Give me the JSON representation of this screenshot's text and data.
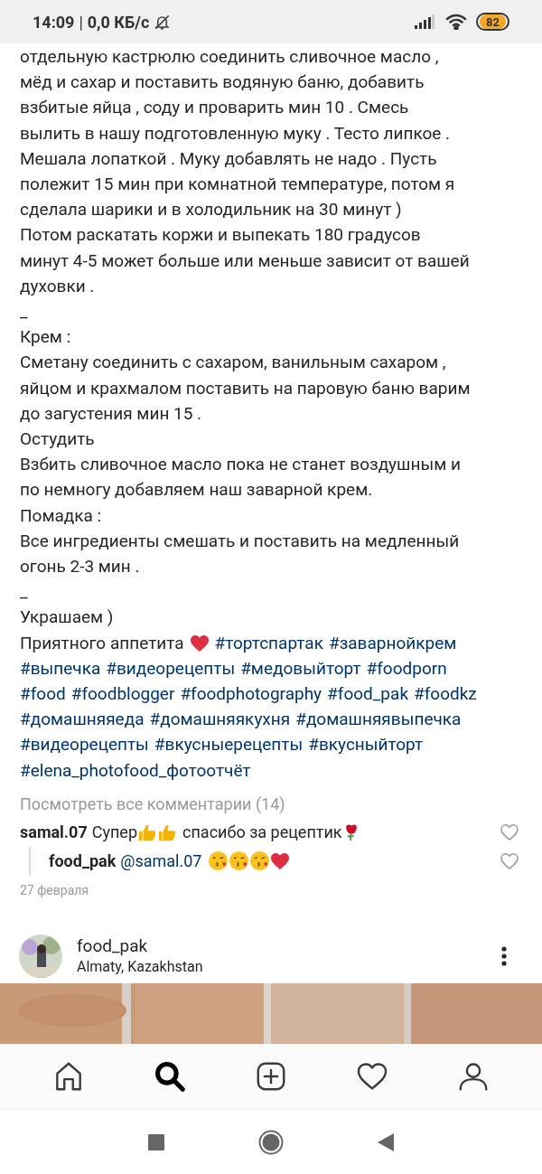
{
  "status_bar": {
    "time": "14:09",
    "separator": "|",
    "speed": "0,0 КБ/с",
    "battery": "82"
  },
  "caption": {
    "lines": [
      "отдельную кастрюлю соединить сливочное масло ,",
      "мёд и сахар и поставить водяную баню, добавить",
      "взбитые яйца , соду и проварить мин 10 . Смесь",
      "вылить в нашу подготовленную муку . Тесто липкое .",
      "Мешала лопаткой . Муку добавлять не надо . Пусть",
      "полежит 15 мин при комнатной температуре, потом я",
      "сделала шарики и в холодильник на 30 минут )",
      "Потом раскатать коржи и выпекать 180 градусов",
      "минут 4-5 может больше или меньше зависит от вашей",
      "духовки .",
      "_",
      "Крем :",
      "Сметану соединить с сахаром, ванильным сахаром ,",
      "яйцом и крахмалом поставить на паровую баню варим",
      "до загустения мин 15 .",
      "Остудить",
      "Взбить сливочное масло пока не станет воздушным и",
      "по немногу добавляем наш заварной крем.",
      "Помадка :",
      "Все ингредиенты смешать и поставить на медленный",
      "огонь 2-3 мин .",
      "_",
      "Украшаем )"
    ],
    "closing": "Приятного аппетита",
    "hashtag_lines": [
      [
        "#тортспартак",
        "#заварнойкрем"
      ],
      [
        "#выпечка",
        "#видеорецепты",
        "#медовыйторт",
        "#foodporn"
      ],
      [
        "#food",
        "#foodblogger",
        "#foodphotography",
        "#food_pak",
        "#foodkz"
      ],
      [
        "#домашняяеда",
        "#домашняякухня",
        "#домашняявыпечка"
      ],
      [
        "#видеорецепты",
        "#вкусныерецепты",
        "#вкусныйторт"
      ],
      [
        "#elena_photofood_фотоотчёт"
      ]
    ]
  },
  "view_comments": "Посмотреть все комментарии (14)",
  "comment": {
    "user": "samal.07",
    "text": "Супер",
    "text_2": "спасибо за рецептик"
  },
  "reply": {
    "user": "food_pak",
    "mention": "@samal.07"
  },
  "date": "27 февраля",
  "next_post": {
    "user": "food_pak",
    "location": "Almaty, Kazakhstan"
  },
  "bottom_nav": [
    {
      "selected": false
    },
    {
      "selected": true
    },
    {
      "selected": false
    },
    {
      "selected": false
    },
    {
      "selected": false
    }
  ]
}
